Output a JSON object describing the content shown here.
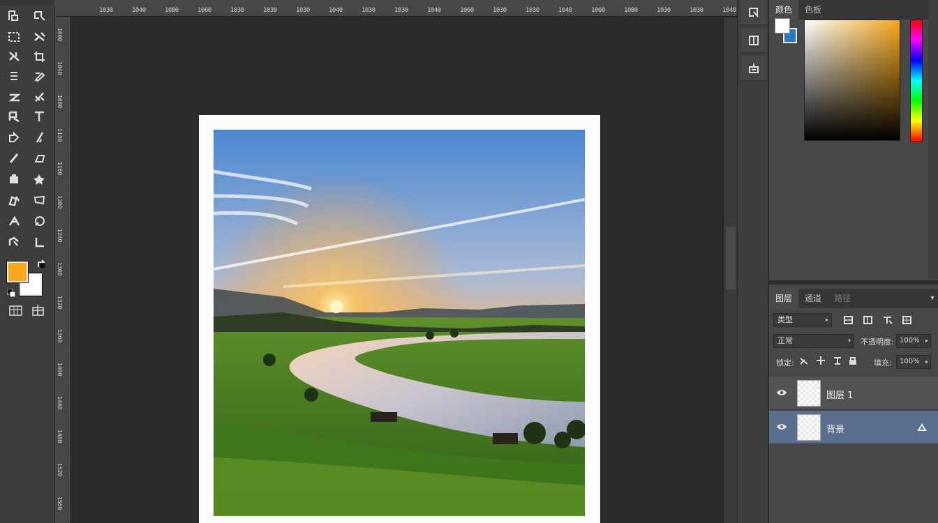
{
  "ruler_top_labels": [
    "1030",
    "1040",
    "1080",
    "1060",
    "1030",
    "1030",
    "1030",
    "1040",
    "1030",
    "1030",
    "1040",
    "1060",
    "1030",
    "1030",
    "1040",
    "1060",
    "1080",
    "1030",
    "1030",
    "1040",
    "1060"
  ],
  "ruler_left_labels": [
    "1000",
    "1040",
    "1080",
    "1130",
    "1160",
    "1200",
    "1240",
    "1300",
    "1320",
    "1360",
    "1400",
    "1440",
    "1480",
    "1520",
    "1560"
  ],
  "toolbar": {
    "tools": [
      "move",
      "artboard",
      "lasso",
      "quick-select",
      "crop",
      "slice",
      "eyedropper",
      "healing",
      "brush",
      "clone",
      "eraser",
      "gradient",
      "blur",
      "dodge",
      "pen",
      "type",
      "path-select",
      "shape",
      "hand",
      "zoom",
      "3d-rotate",
      "note"
    ],
    "foreground_color": "#f7a81b",
    "background_color": "#ffffff"
  },
  "icon_strip": {
    "buttons": [
      "history",
      "properties",
      "adjustments"
    ]
  },
  "color_panel": {
    "tabs": [
      "颜色",
      "色板"
    ],
    "fg_color": "#ffffff",
    "bg_color": "#2a7bbd",
    "field_hue": "#f7a81b"
  },
  "layers_panel": {
    "tabs": [
      "图层",
      "通道",
      "路径"
    ],
    "kind_filter": "类型",
    "blend_mode": "正常",
    "opacity_label": "不透明度:",
    "opacity_value": "100%",
    "lock_label": "锁定:",
    "fill_label": "填充:",
    "fill_value": "100%",
    "layers": [
      {
        "name": "图层 1",
        "visible": true,
        "selected": false
      },
      {
        "name": "背景",
        "visible": true,
        "selected": true
      }
    ]
  },
  "colors": {
    "accent_selected_layer": "#5a6f8f",
    "workspace": "#2b2b2b"
  }
}
